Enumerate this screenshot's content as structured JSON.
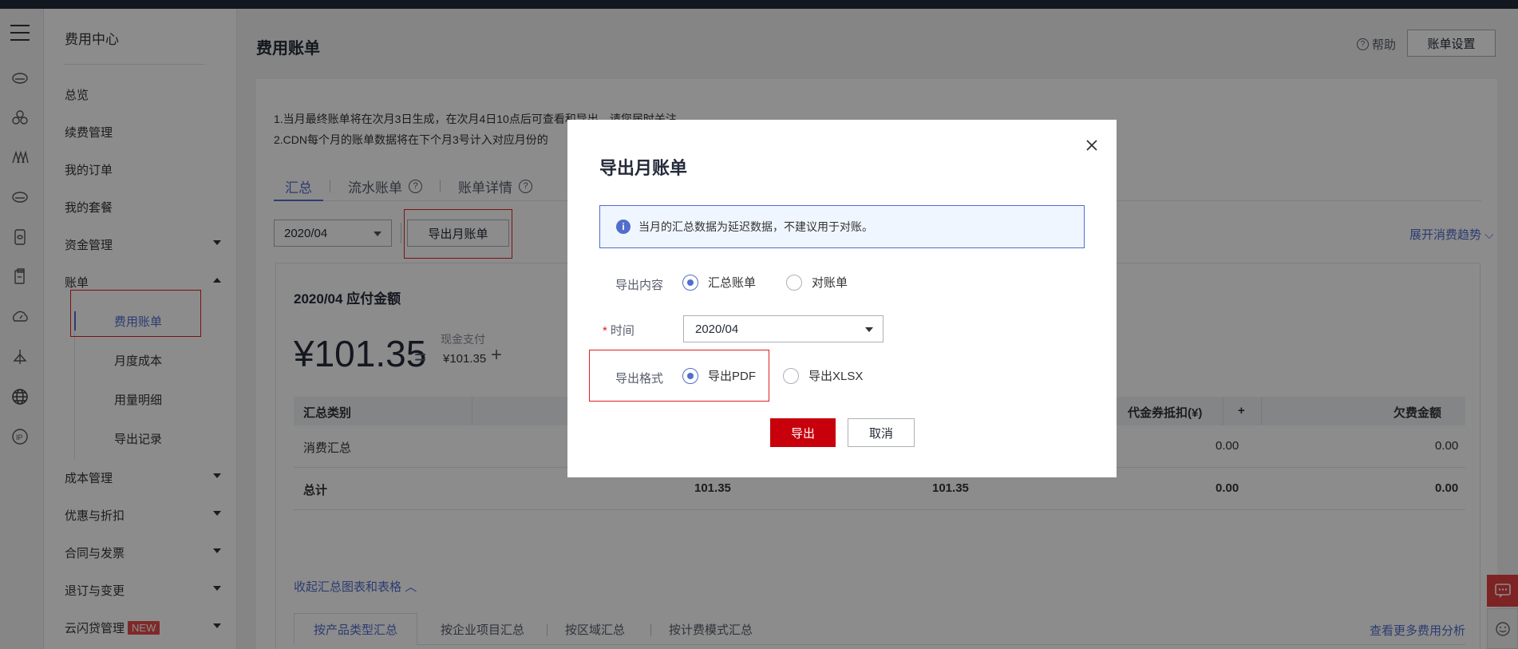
{
  "sidebar": {
    "title": "费用中心",
    "items": [
      {
        "label": "总览"
      },
      {
        "label": "续费管理"
      },
      {
        "label": "我的订单"
      },
      {
        "label": "我的套餐"
      },
      {
        "label": "资金管理"
      },
      {
        "label": "账单"
      },
      {
        "label": "成本管理"
      },
      {
        "label": "优惠与折扣"
      },
      {
        "label": "合同与发票"
      },
      {
        "label": "退订与变更"
      },
      {
        "label": "云闪贷管理"
      }
    ],
    "sub_items": [
      {
        "label": "费用账单"
      },
      {
        "label": "月度成本"
      },
      {
        "label": "用量明细"
      },
      {
        "label": "导出记录"
      }
    ],
    "new_badge": "NEW"
  },
  "header": {
    "title": "费用账单",
    "help": "帮助",
    "settings": "账单设置"
  },
  "notices": [
    "1.当月最终账单将在次月3日生成，在次月4日10点后可查看和导出，请您届时关注。",
    "2.CDN每个月的账单数据将在下个月3号计入对应月份的"
  ],
  "tabs": [
    {
      "label": "汇总"
    },
    {
      "label": "流水账单"
    },
    {
      "label": "账单详情"
    }
  ],
  "toolbar": {
    "month": "2020/04",
    "export_button": "导出月账单",
    "expand_link": "展开消费趋势"
  },
  "summary": {
    "title": "2020/04 应付金额",
    "total": "¥101.35",
    "equals": "=",
    "plus": "+",
    "cash_label": "现金支付",
    "cash_value": "¥101.35"
  },
  "table": {
    "headers": [
      "汇总类别",
      "代金券抵扣(¥)",
      "+",
      "欠费金额"
    ],
    "rows": [
      {
        "category": "消费汇总",
        "coupon": "0.00",
        "arrears": "0.00"
      },
      {
        "category": "总计",
        "col2": "101.35",
        "col3": "101.35",
        "coupon": "0.00",
        "arrears": "0.00"
      }
    ]
  },
  "collapse_link": "收起汇总图表和表格",
  "subtabs": [
    "按产品类型汇总",
    "按企业项目汇总",
    "按区域汇总",
    "按计费模式汇总"
  ],
  "more_link": "查看更多费用分析",
  "modal": {
    "title": "导出月账单",
    "info": "当月的汇总数据为延迟数据，不建议用于对账。",
    "content_label": "导出内容",
    "content_options": [
      "汇总账单",
      "对账单"
    ],
    "content_selected": "汇总账单",
    "time_required": "*",
    "time_label": "时间",
    "time_value": "2020/04",
    "format_label": "导出格式",
    "format_options": [
      "导出PDF",
      "导出XLSX"
    ],
    "format_selected": "导出PDF",
    "confirm": "导出",
    "cancel": "取消"
  },
  "colors": {
    "accent": "#526ecc",
    "primary_button": "#c7000b",
    "highlight_box": "#e02020"
  }
}
